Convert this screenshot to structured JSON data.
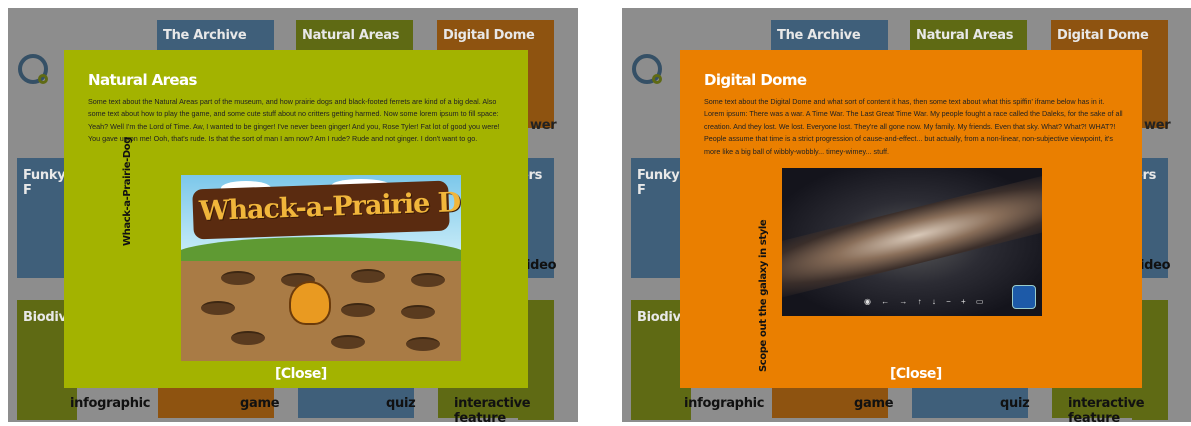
{
  "tiles": {
    "archive": "The Archive",
    "natural_areas": "Natural Areas",
    "digital_dome": "Digital Dome",
    "funky": "Funky F",
    "biodive": "Biodive",
    "ewer": "wer",
    "ers": "ers",
    "video": "ideo",
    "infographic": "infographic",
    "game": "game",
    "quiz": "quiz",
    "interactive_feature": "interactive feature"
  },
  "left_modal": {
    "title": "Natural Areas",
    "body": "Some text about the Natural Areas part of the museum, and how prairie dogs and black-footed ferrets are kind of a big deal. Also some text about how to play the game, and some cute stuff about no critters getting harmed. Now some lorem ipsum to fill space: Yeah? Well I'm the Lord of Time. Aw, I wanted to be ginger! I've never been ginger! And you, Rose Tyler! Fat lot of good you were! You gave up on me! Ooh, that's rude. Is that the sort of man I am now? Am I rude? Rude and not ginger. I don't want to go.",
    "side_label": "Whack-a-Prairie-Dog",
    "game_title": "Whack-a-Prairie Dog",
    "close": "[Close]"
  },
  "right_modal": {
    "title": "Digital Dome",
    "body": "Some text about the Digital Dome and what sort of content it has, then some text about what this spiffin' iframe below has in it. Lorem ipsum: There was a war. A Time War. The Last Great Time War. My people fought a race called the Daleks, for the sake of all creation. And they lost. We lost. Everyone lost. They're all gone now. My family. My friends. Even that sky. What? What?! WHAT?! People assume that time is a strict progression of cause-and-effect... but actually, from a non-linear, non-subjective viewpoint, it's more like a big ball of wibbly-wobbly... timey-wimey... stuff.",
    "side_label": "Scope out the galaxy in style",
    "controls": "◉ ← → ↑ ↓ − + ▭",
    "close": "[Close]"
  },
  "colors": {
    "green_modal": "#a3b300",
    "orange_modal": "#ea7f00",
    "dim_overlay": "#8d8d8d"
  }
}
